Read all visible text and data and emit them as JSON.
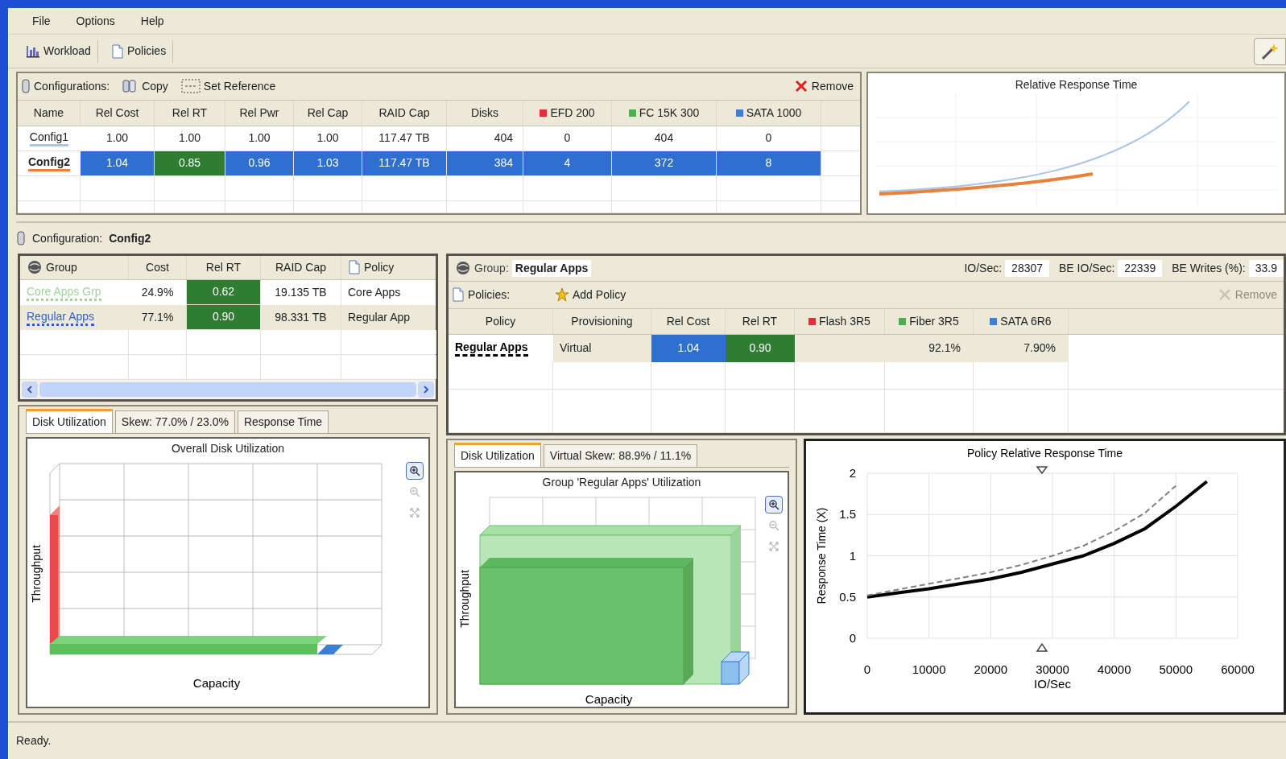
{
  "menu": [
    {
      "label": "File"
    },
    {
      "label": "Options"
    },
    {
      "label": "Help"
    }
  ],
  "toolbar": [
    {
      "label": "Workload",
      "kind": "chart"
    },
    {
      "label": "Policies",
      "kind": "document"
    }
  ],
  "configurations": {
    "label": "Configurations:",
    "actions": [
      {
        "label": "Copy",
        "kind": "copy"
      },
      {
        "label": "Set Reference",
        "kind": "reference"
      }
    ],
    "remove": {
      "label": "Remove",
      "disabled": false
    },
    "table": {
      "columns": [
        {
          "label": "Name"
        },
        {
          "label": "Rel Cost"
        },
        {
          "label": "Rel RT"
        },
        {
          "label": "Rel Pwr"
        },
        {
          "label": "Rel Cap"
        },
        {
          "label": "RAID Cap"
        },
        {
          "label": "Disks"
        },
        {
          "label": "EFD 200",
          "color": "#e0303c"
        },
        {
          "label": "FC 15K 300",
          "color": "#4caf50"
        },
        {
          "label": "SATA 1000",
          "color": "#3d7fd6"
        }
      ],
      "rows": [
        {
          "color": "#a9c4e8",
          "selected": false,
          "rel_rt_better": false,
          "cells": [
            "Config1",
            "1.00",
            "1.00",
            "1.00",
            "1.00",
            "117.47 TB",
            "404",
            "0",
            "404",
            "0"
          ]
        },
        {
          "color": "#e8823a",
          "selected": true,
          "rel_rt_better": true,
          "cells": [
            "Config2",
            "1.04",
            "0.85",
            "0.96",
            "1.03",
            "117.47 TB",
            "384",
            "4",
            "372",
            "8"
          ]
        }
      ]
    }
  },
  "relative_response_chart": {
    "title": "Relative Response Time"
  },
  "configuration": {
    "label": "Configuration:",
    "value": "Config2"
  },
  "groups": {
    "columns": [
      {
        "label": "Group",
        "kind": "group"
      },
      {
        "label": "Cost"
      },
      {
        "label": "Rel RT"
      },
      {
        "label": "RAID Cap"
      },
      {
        "label": "Policy",
        "kind": "policy"
      }
    ],
    "rows": [
      {
        "color": "#9fd49a",
        "selected": false,
        "rel_rt_better": true,
        "cells": [
          "Core Apps Grp",
          "24.9%",
          "0.62",
          "19.135 TB",
          "Core Apps"
        ]
      },
      {
        "color": "#2f5fd0",
        "selected": true,
        "rel_rt_better": true,
        "cells": [
          "Regular Apps",
          "77.1%",
          "0.90",
          "98.331 TB",
          "Regular App"
        ]
      }
    ]
  },
  "left_tabs": [
    {
      "label": "Disk Utilization",
      "selected": true
    },
    {
      "label": "Skew: 77.0% / 23.0%",
      "selected": false
    },
    {
      "label": "Response Time",
      "selected": false
    }
  ],
  "overall_chart": {
    "title": "Overall Disk Utilization",
    "ylabel": "Throughput",
    "xlabel": "Capacity"
  },
  "group": {
    "label": "Group:",
    "value": "Regular Apps",
    "stats": [
      {
        "label": "IO/Sec:",
        "value": "28307"
      },
      {
        "label": "BE IO/Sec:",
        "value": "22339"
      },
      {
        "label": "BE Writes (%):",
        "value": "33.9"
      }
    ]
  },
  "policies": {
    "label": "Policies:",
    "add": "Add Policy",
    "remove": {
      "label": "Remove",
      "disabled": true
    },
    "table": {
      "columns": [
        {
          "label": "Policy"
        },
        {
          "label": "Provisioning"
        },
        {
          "label": "Rel Cost"
        },
        {
          "label": "Rel RT"
        },
        {
          "label": "Flash 3R5",
          "color": "#e0303c"
        },
        {
          "label": "Fiber 3R5",
          "color": "#4caf50"
        },
        {
          "label": "SATA 6R6",
          "color": "#3d7fd6"
        }
      ],
      "rows": [
        {
          "name": "Regular Apps",
          "color": "#000000",
          "selected": true,
          "rel_cost_worse": true,
          "rel_rt_better": true,
          "provisioning": "Virtual",
          "rel_cost": "1.04",
          "rel_rt": "0.90",
          "fiber": "92.1%",
          "sata": "7.90%"
        }
      ]
    }
  },
  "right_tabs": [
    {
      "label": "Disk Utilization",
      "selected": true
    },
    {
      "label": "Virtual Skew: 88.9% / 11.1%",
      "selected": false
    }
  ],
  "group_chart": {
    "title": "Group 'Regular Apps' Utilization",
    "ylabel": "Throughput",
    "xlabel": "Capacity"
  },
  "policy_chart": {
    "chart_data": {
      "type": "line",
      "title": "Policy Relative Response Time",
      "xlabel": "IO/Sec",
      "ylabel": "Response Time (X)",
      "x": [
        0,
        5000,
        10000,
        15000,
        20000,
        25000,
        30000,
        35000,
        40000,
        45000,
        50000,
        55000
      ],
      "series": [
        {
          "color": "#000000",
          "line_style": "solid",
          "values": [
            0.5,
            0.55,
            0.6,
            0.66,
            0.72,
            0.8,
            0.9,
            1.0,
            1.15,
            1.33,
            1.6,
            1.9
          ]
        },
        {
          "color": "#808080",
          "line_style": "dashed",
          "values": [
            0.52,
            0.59,
            0.66,
            0.73,
            0.8,
            0.89,
            1.0,
            1.12,
            1.3,
            1.52,
            1.85,
            null
          ]
        }
      ],
      "grid": true,
      "xlim": [
        0,
        60000
      ],
      "ylim": [
        0,
        2
      ],
      "xticks": [
        0,
        10000,
        20000,
        30000,
        40000,
        50000,
        60000
      ],
      "yticks": [
        0,
        0.5,
        1,
        1.5,
        2
      ]
    }
  },
  "status_bar": "Ready."
}
